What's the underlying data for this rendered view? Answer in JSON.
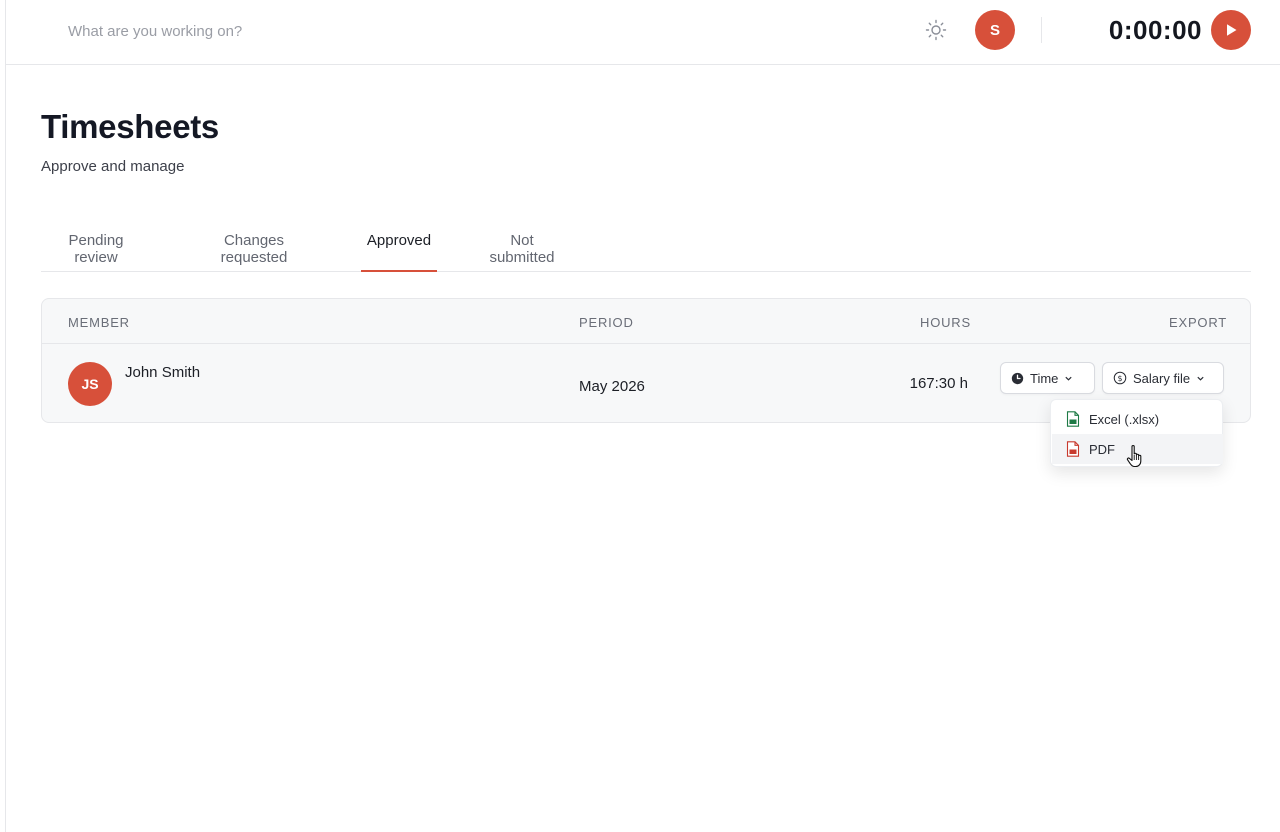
{
  "topbar": {
    "task_placeholder": "What are you working on?",
    "user_initial": "S",
    "timer": "0:00:00"
  },
  "header": {
    "title": "Timesheets",
    "subtitle": "Approve and manage"
  },
  "tabs": [
    {
      "label": "Pending review"
    },
    {
      "label": "Changes requested"
    },
    {
      "label": "Approved"
    },
    {
      "label": "Not submitted"
    }
  ],
  "active_tab": "Approved",
  "table": {
    "columns": [
      "MEMBER",
      "PERIOD",
      "HOURS",
      "EXPORT"
    ],
    "rows": [
      {
        "initials": "JS",
        "member": "John Smith",
        "period": "May 2026",
        "hours": "167:30 h",
        "export_time_label": "Time",
        "export_salary_label": "Salary file"
      }
    ]
  },
  "export_menu": {
    "items": [
      {
        "label": "Excel (.xlsx)",
        "icon": "excel-file-icon"
      },
      {
        "label": "PDF",
        "icon": "pdf-file-icon"
      }
    ],
    "hovered": "PDF"
  },
  "colors": {
    "accent": "#d7503a",
    "excel": "#1d7a45",
    "pdf": "#c83a2e"
  }
}
